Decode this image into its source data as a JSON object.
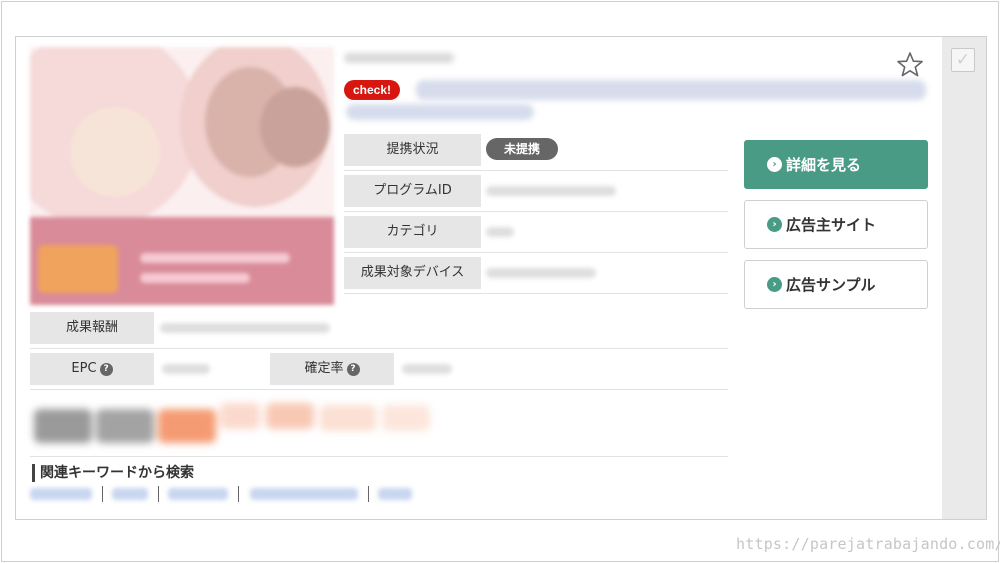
{
  "card": {
    "check_badge": "check!",
    "spec": [
      {
        "label": "提携状況",
        "status": "未提携"
      },
      {
        "label": "プログラムID"
      },
      {
        "label": "カテゴリ"
      },
      {
        "label": "成果対象デバイス"
      }
    ],
    "reward_label": "成果報酬",
    "epc_label": "EPC",
    "confirm_rate_label": "確定率",
    "help_glyph": "?",
    "keyword_heading": "関連キーワードから検索"
  },
  "buttons": {
    "details": "詳細を見る",
    "advertiser_site": "広告主サイト",
    "ad_sample": "広告サンプル",
    "arrow_glyph": "›"
  },
  "icons": {
    "favorite": "star-outline-icon",
    "select": "checkbox-icon",
    "select_glyph": "✓"
  },
  "colors": {
    "primary_button": "#4a9b85",
    "check_badge": "#d7160f",
    "status_pill": "#666666",
    "label_bg": "#e6e6e6"
  },
  "watermark": "https://parejatrabajando.com/"
}
